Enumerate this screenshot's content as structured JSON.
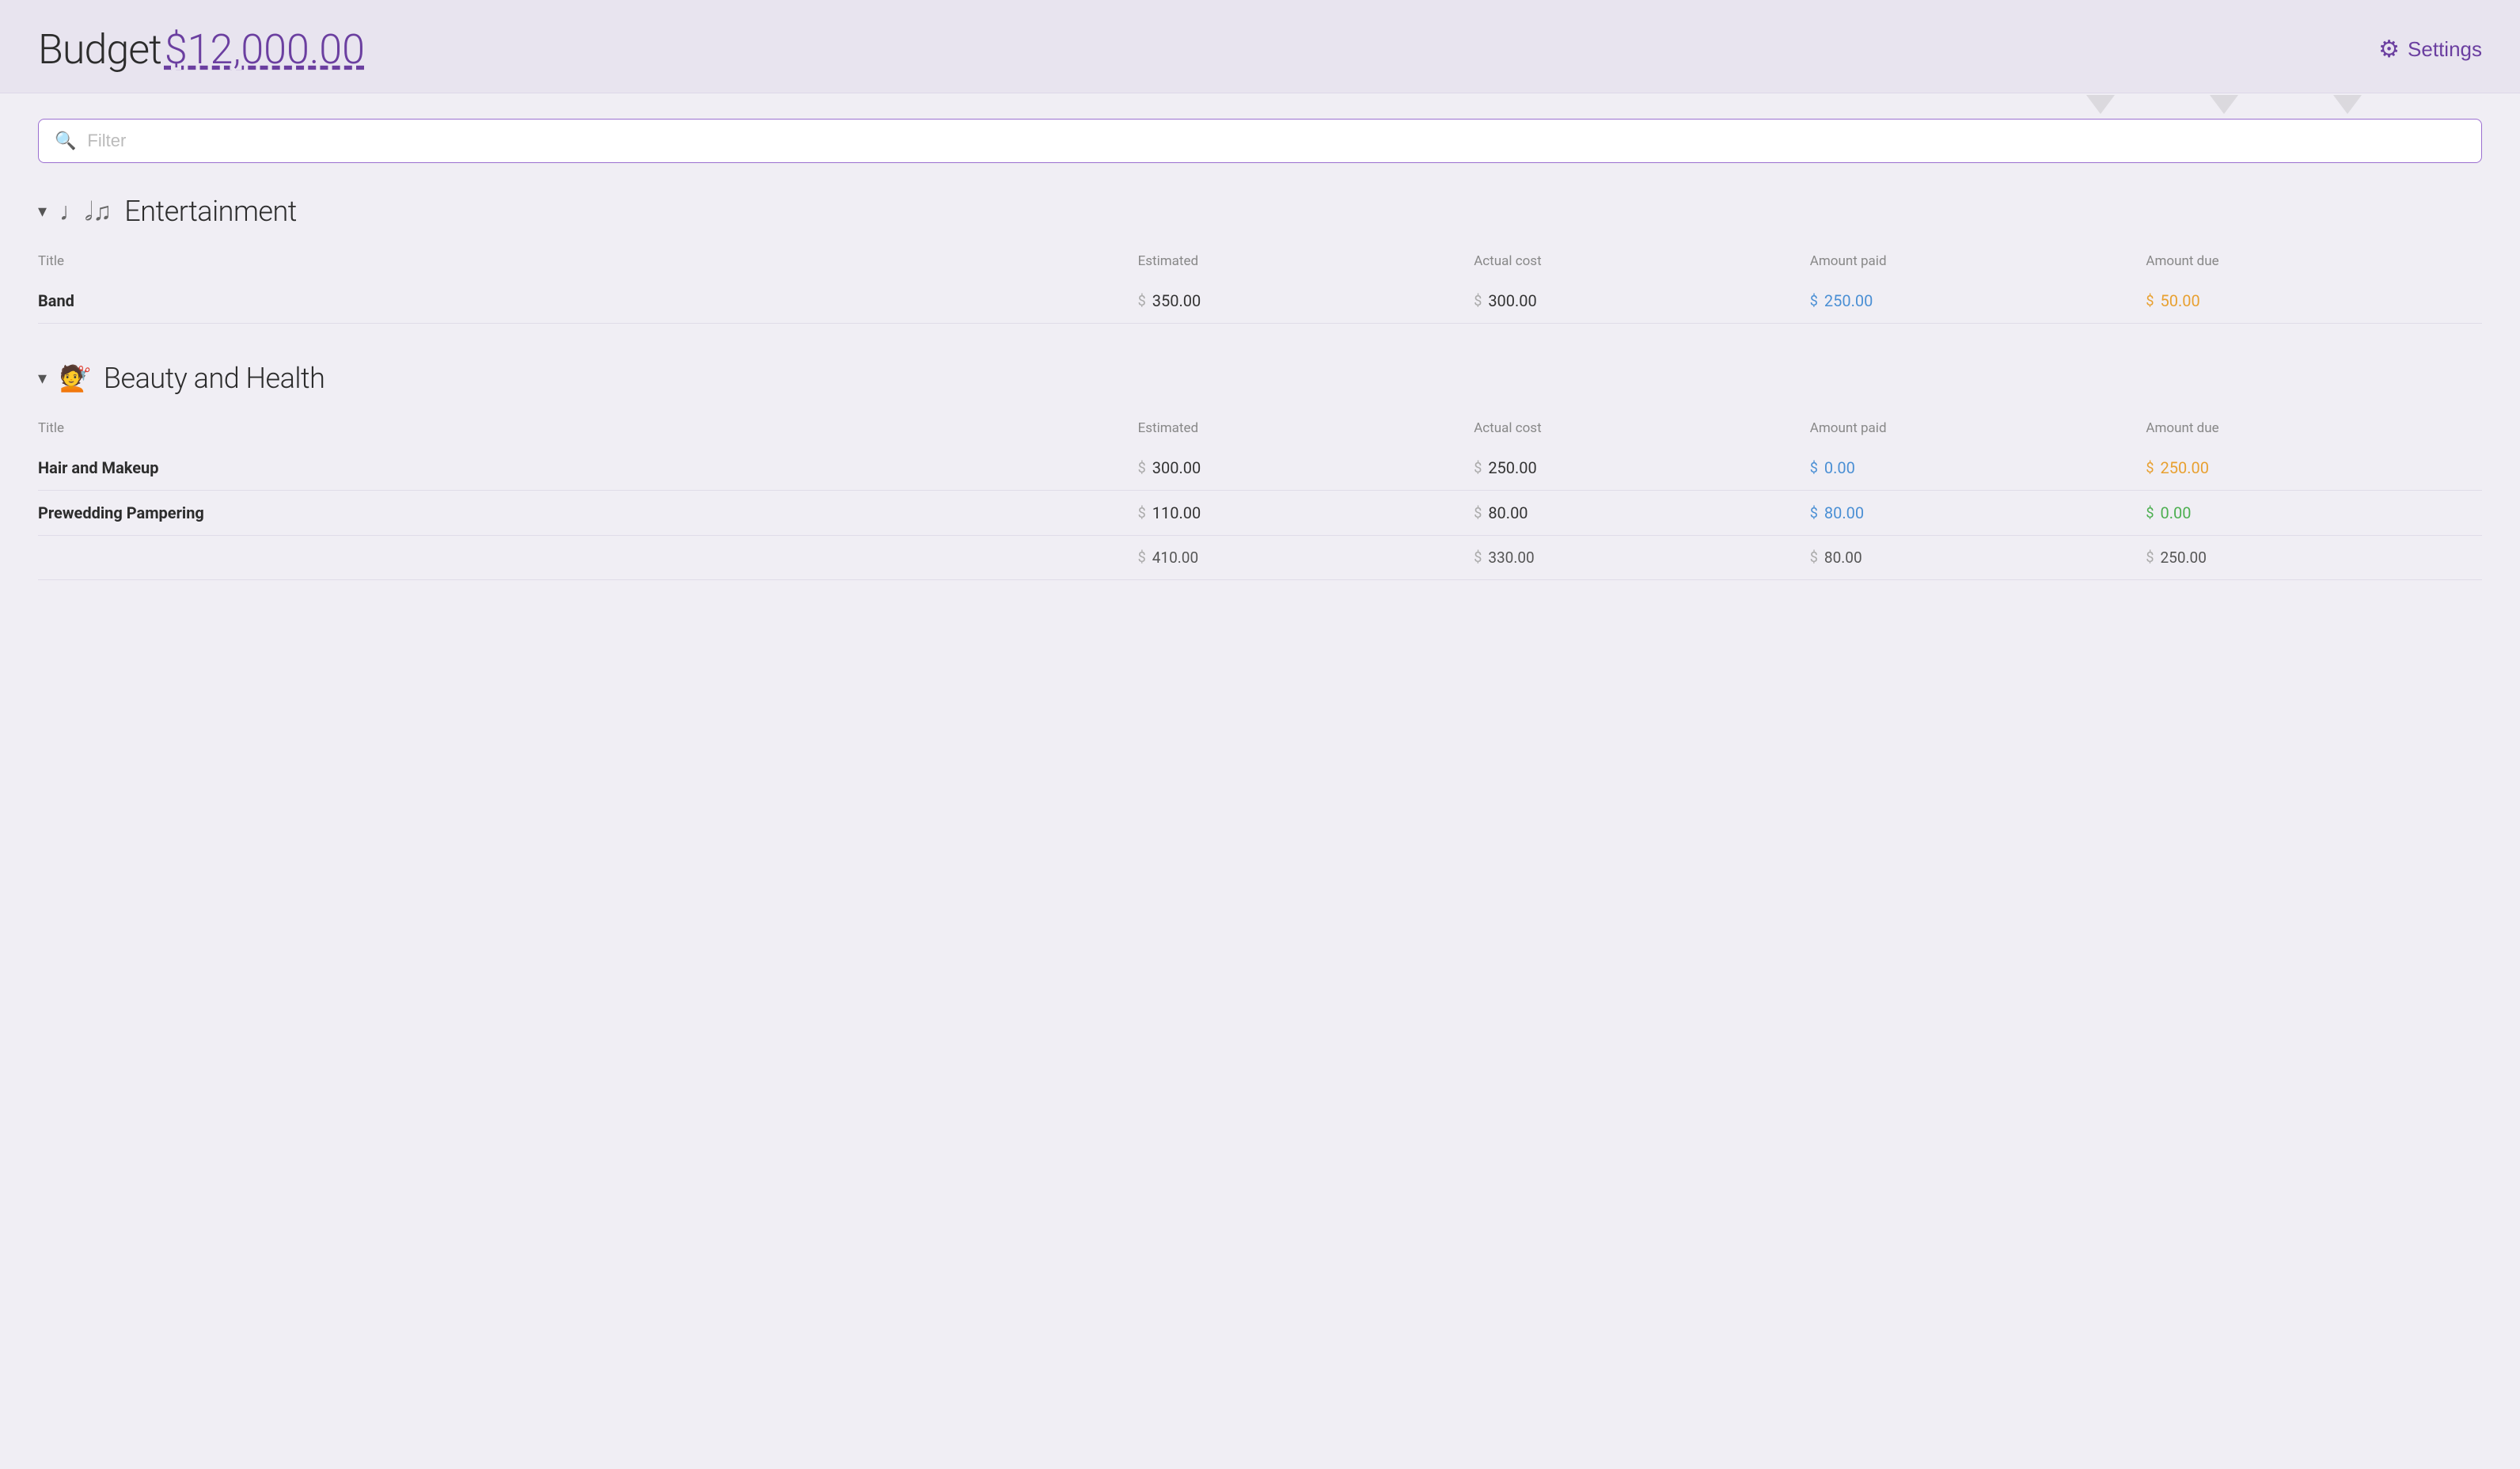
{
  "header": {
    "title_prefix": "Budget",
    "budget_amount": "$12,000.00",
    "settings_label": "Settings"
  },
  "filter": {
    "placeholder": "Filter"
  },
  "categories": [
    {
      "id": "entertainment",
      "icon": "♩♫",
      "title": "Entertainment",
      "columns": {
        "title": "Title",
        "estimated": "Estimated",
        "actual_cost": "Actual cost",
        "amount_paid": "Amount paid",
        "amount_due": "Amount due"
      },
      "rows": [
        {
          "title": "Band",
          "estimated": "350.00",
          "actual_cost": "300.00",
          "amount_paid": "250.00",
          "amount_due": "50.00",
          "paid_color": "blue",
          "due_color": "orange"
        }
      ],
      "totals": null
    },
    {
      "id": "beauty-health",
      "icon": "💇",
      "title": "Beauty and Health",
      "columns": {
        "title": "Title",
        "estimated": "Estimated",
        "actual_cost": "Actual cost",
        "amount_paid": "Amount paid",
        "amount_due": "Amount due"
      },
      "rows": [
        {
          "title": "Hair and Makeup",
          "estimated": "300.00",
          "actual_cost": "250.00",
          "amount_paid": "0.00",
          "amount_due": "250.00",
          "paid_color": "blue",
          "due_color": "orange"
        },
        {
          "title": "Prewedding Pampering",
          "estimated": "110.00",
          "actual_cost": "80.00",
          "amount_paid": "80.00",
          "amount_due": "0.00",
          "paid_color": "blue",
          "due_color": "green"
        }
      ],
      "totals": {
        "estimated": "410.00",
        "actual_cost": "330.00",
        "amount_paid": "80.00",
        "amount_due": "250.00"
      }
    }
  ],
  "icons": {
    "chevron_down": "▾",
    "search": "🔍",
    "gear": "⚙",
    "music": "𝅘𝅥𝅮",
    "hairdryer": "💇"
  }
}
